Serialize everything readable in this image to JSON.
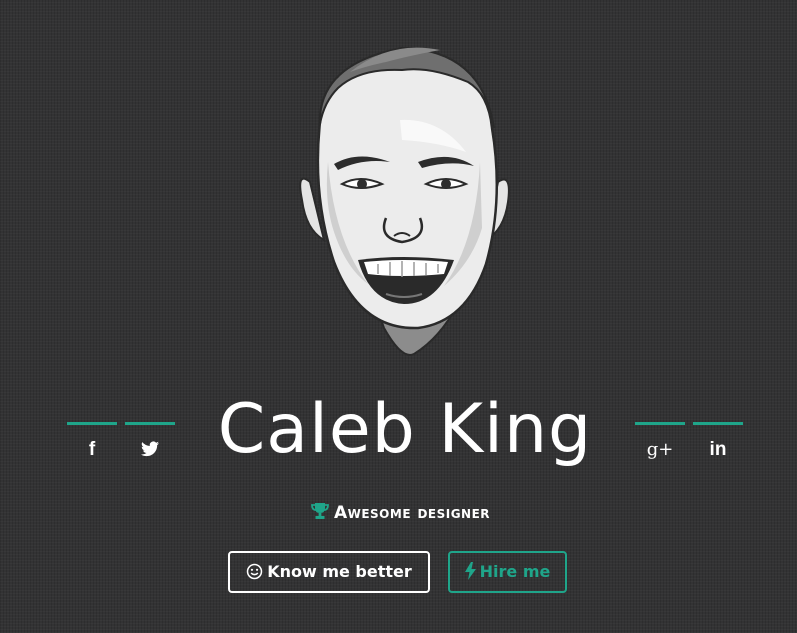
{
  "profile": {
    "name": "Caleb King",
    "tagline": "Awesome designer"
  },
  "social": [
    {
      "icon": "facebook-icon",
      "glyph": "f"
    },
    {
      "icon": "twitter-icon",
      "glyph": ""
    },
    {
      "icon": "google-plus-icon",
      "glyph": "g+"
    },
    {
      "icon": "linkedin-icon",
      "glyph": "in"
    }
  ],
  "buttons": {
    "know_label": "Know me better",
    "hire_label": "Hire me"
  },
  "icons": {
    "tagline_icon": "trophy-icon",
    "know_icon": "smiley-icon",
    "hire_icon": "lightning-bolt-icon"
  },
  "colors": {
    "accent": "#1fa58a",
    "background": "#333334",
    "text": "#ffffff"
  }
}
